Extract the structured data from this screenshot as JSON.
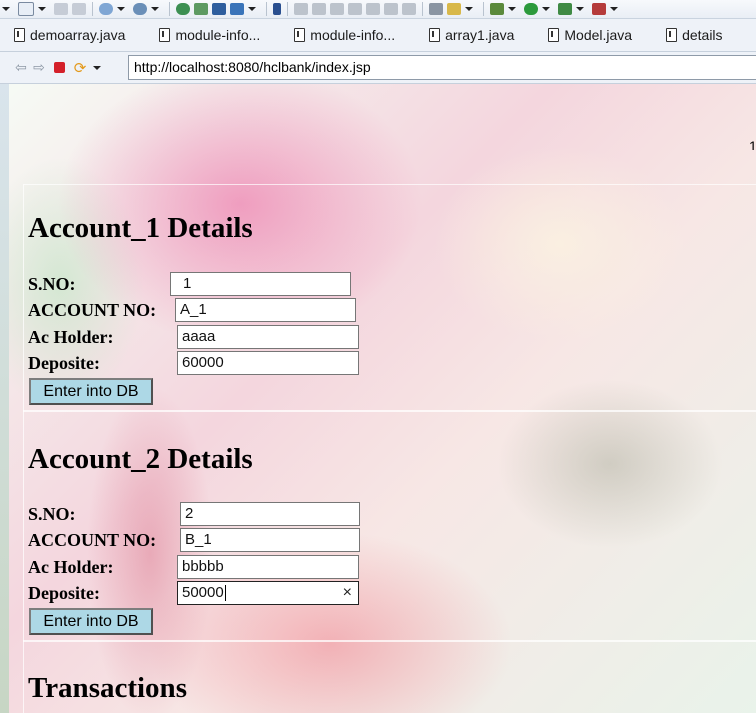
{
  "tabs": [
    {
      "label": "demoarray.java"
    },
    {
      "label": "module-info..."
    },
    {
      "label": "module-info..."
    },
    {
      "label": "array1.java"
    },
    {
      "label": "Model.java"
    },
    {
      "label": "details"
    }
  ],
  "browser": {
    "url": "http://localhost:8080/hclbank/index.jsp"
  },
  "account1": {
    "title": "Account_1 Details",
    "sno_label": "S.NO:",
    "sno_value": "1",
    "account_label": "ACCOUNT NO:",
    "account_value": "A_1",
    "holder_label": "Ac Holder:",
    "holder_value": "aaaa",
    "deposit_label": "Deposite:",
    "deposit_value": "60000",
    "button": "Enter into DB"
  },
  "account2": {
    "title": "Account_2 Details",
    "sno_label": "S.NO:",
    "sno_value": "2",
    "account_label": "ACCOUNT NO:",
    "account_value": "B_1",
    "holder_label": "Ac Holder:",
    "holder_value": "bbbbb",
    "deposit_label": "Deposite:",
    "deposit_value": "50000",
    "button": "Enter into DB"
  },
  "transactions": {
    "title": "Transactions"
  },
  "colors": {
    "button_bg": "#add8e6",
    "stop_red": "#d4202a"
  }
}
